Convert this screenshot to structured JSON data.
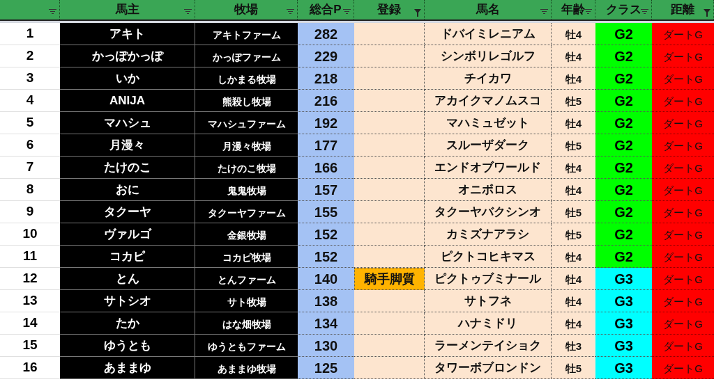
{
  "columns": [
    {
      "filtered": false
    },
    {
      "label": "馬主",
      "filtered": false
    },
    {
      "label": "牧場",
      "filtered": false
    },
    {
      "label": "総合P",
      "filtered": false
    },
    {
      "label": "登録",
      "filtered": true
    },
    {
      "label": "馬名",
      "filtered": false
    },
    {
      "label": "年齢",
      "filtered": false
    },
    {
      "label": "クラス",
      "filtered": false
    },
    {
      "label": "距離",
      "filtered": true
    }
  ],
  "rows": [
    {
      "rank": "1",
      "owner": "アキト",
      "farm": "アキトファーム",
      "points": "282",
      "horse": "ドバイミレニアム",
      "age": "牡4",
      "class": "G2",
      "color": "#00ff00",
      "distance": "ダートG"
    },
    {
      "rank": "2",
      "owner": "かっぽかっぽ",
      "farm": "かっぽファーム",
      "points": "229",
      "horse": "シンボリレゴルフ",
      "age": "牡4",
      "class": "G2",
      "color": "#00ff00",
      "distance": "ダートG"
    },
    {
      "rank": "3",
      "owner": "いか",
      "farm": "しかまる牧場",
      "points": "218",
      "horse": "チイカワ",
      "age": "牡4",
      "class": "G2",
      "color": "#00ff00",
      "distance": "ダートG"
    },
    {
      "rank": "4",
      "owner": "ANIJA",
      "farm": "熊殺し牧場",
      "points": "216",
      "horse": "アカイクマノムスコ",
      "age": "牡5",
      "class": "G2",
      "color": "#00ff00",
      "distance": "ダートG"
    },
    {
      "rank": "5",
      "owner": "マハシュ",
      "farm": "マハシュファーム",
      "points": "192",
      "horse": "マハミュゼット",
      "age": "牡4",
      "class": "G2",
      "color": "#00ff00",
      "distance": "ダートG"
    },
    {
      "rank": "6",
      "owner": "月漫々",
      "farm": "月漫々牧場",
      "points": "177",
      "horse": "スルーザダーク",
      "age": "牡5",
      "class": "G2",
      "color": "#00ff00",
      "distance": "ダートG"
    },
    {
      "rank": "7",
      "owner": "たけのこ",
      "farm": "たけのこ牧場",
      "points": "166",
      "horse": "エンドオブワールド",
      "age": "牡4",
      "class": "G2",
      "color": "#00ff00",
      "distance": "ダートG"
    },
    {
      "rank": "8",
      "owner": "おに",
      "farm": "鬼鬼牧場",
      "points": "157",
      "horse": "オニボロス",
      "age": "牡4",
      "class": "G2",
      "color": "#00ff00",
      "distance": "ダートG"
    },
    {
      "rank": "9",
      "owner": "タクーヤ",
      "farm": "タクーヤファーム",
      "points": "155",
      "horse": "タクーヤバクシンオ",
      "age": "牡5",
      "class": "G2",
      "color": "#00ff00",
      "distance": "ダートG"
    },
    {
      "rank": "10",
      "owner": "ヴァルゴ",
      "farm": "金銀牧場",
      "points": "152",
      "horse": "カミズナアラシ",
      "age": "牡5",
      "class": "G2",
      "color": "#00ff00",
      "distance": "ダートG"
    },
    {
      "rank": "11",
      "owner": "コカピ",
      "farm": "コカピ牧場",
      "points": "152",
      "horse": "ピクトコヒキマス",
      "age": "牡4",
      "class": "G2",
      "color": "#00ff00",
      "distance": "ダートG"
    },
    {
      "rank": "12",
      "owner": "とん",
      "farm": "とんファーム",
      "points": "140",
      "registration": "騎手脚質",
      "horse": "ピクトゥブミナール",
      "age": "牡4",
      "class": "G3",
      "color": "#00ffff",
      "distance": "ダートG"
    },
    {
      "rank": "13",
      "owner": "サトシオ",
      "farm": "サト牧場",
      "points": "138",
      "horse": "サトフネ",
      "age": "牡4",
      "class": "G3",
      "color": "#00ffff",
      "distance": "ダートG"
    },
    {
      "rank": "14",
      "owner": "たか",
      "farm": "はな畑牧場",
      "points": "134",
      "horse": "ハナミドリ",
      "age": "牡4",
      "class": "G3",
      "color": "#00ffff",
      "distance": "ダートG"
    },
    {
      "rank": "15",
      "owner": "ゆうとも",
      "farm": "ゆうともファーム",
      "points": "130",
      "horse": "ラーメンテイショク",
      "age": "牡3",
      "class": "G3",
      "color": "#00ffff",
      "distance": "ダートG"
    },
    {
      "rank": "16",
      "owner": "あままゆ",
      "farm": "あままゆ牧場",
      "points": "125",
      "horse": "タワーボブロンドン",
      "age": "牡5",
      "class": "G3",
      "color": "#00ffff",
      "distance": "ダートG"
    }
  ]
}
